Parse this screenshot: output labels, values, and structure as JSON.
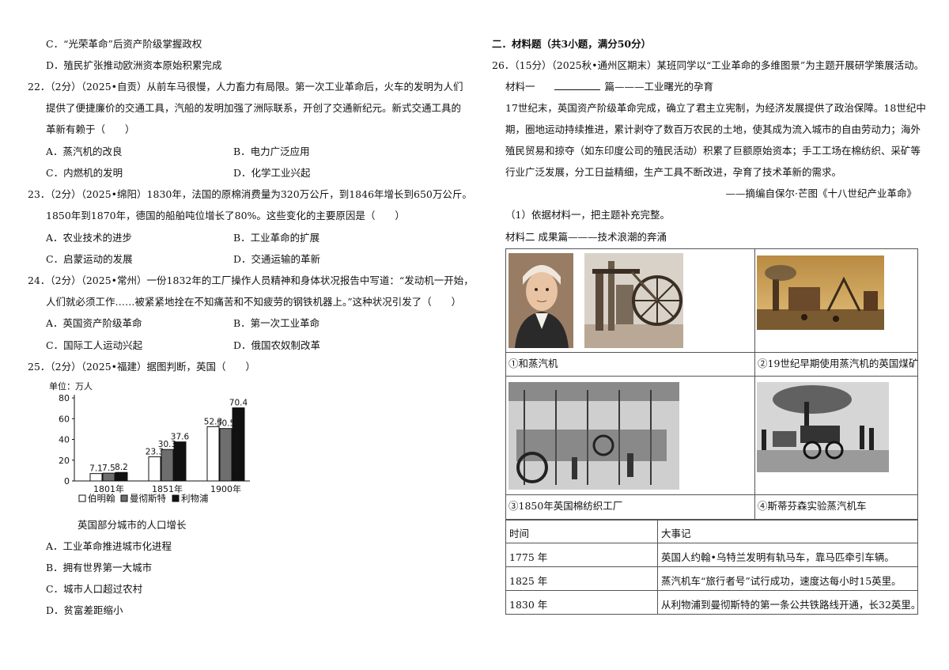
{
  "left": {
    "q21_opts": [
      "C．“光荣革命”后资产阶级掌握政权",
      "D．殖民扩张推动欧洲资本原始积累完成"
    ],
    "q22": {
      "lines": [
        "22．（2分）（2025•自贡）从前车马很慢，人力畜力有局限。第一次工业革命后，火车的发明为人们",
        "提供了便捷廉价的交通工具，汽船的发明加强了洲际联系，开创了交通新纪元。新式交通工具的",
        "革新有赖于（　　）"
      ],
      "opts": [
        "A．蒸汽机的改良",
        "B．电力广泛应用",
        "C．内燃机的发明",
        "D．化学工业兴起"
      ]
    },
    "q23": {
      "lines": [
        "23．（2分）（2025•绵阳）1830年，法国的原棉消费量为320万公斤，到1846年增长到650万公斤。",
        "1850年到1870年，德国的船舶吨位增长了80%。这些变化的主要原因是（　　）"
      ],
      "opts": [
        "A．农业技术的进步",
        "B．工业革命的扩展",
        "C．启蒙运动的发展",
        "D．交通运输的革新"
      ]
    },
    "q24": {
      "lines": [
        "24．（2分）（2025•常州）一份1832年的工厂操作人员精神和身体状况报告中写道：“发动机一开始，",
        "人们就必须工作……被紧紧地拴在不知痛苦和不知疲劳的钢铁机器上。”这种状况引发了（　　）"
      ],
      "opts": [
        "A．英国资产阶级革命",
        "B．第一次工业革命",
        "C．国际工人运动兴起",
        "D．俄国农奴制改革"
      ]
    },
    "q25": {
      "line": "25．（2分）（2025•福建）据图判断，英国（　　）",
      "opts": [
        "A．工业革命推进城市化进程",
        "B．拥有世界第一大城市",
        "C．城市人口超过农村",
        "D．贫富差距缩小"
      ]
    }
  },
  "chart_data": {
    "type": "bar",
    "title": "英国部分城市的人口增长",
    "ylabel": "单位：万人",
    "categories": [
      "1801年",
      "1851年",
      "1900年"
    ],
    "series": [
      {
        "name": "伯明翰",
        "values": [
          7.1,
          23.3,
          52.3
        ],
        "color": "#ffffff"
      },
      {
        "name": "曼彻斯特",
        "values": [
          7.5,
          30.3,
          50.5
        ],
        "color": "#6e6e6e"
      },
      {
        "name": "利物浦",
        "values": [
          8.2,
          37.6,
          70.4
        ],
        "color": "#111111"
      }
    ],
    "yticks": [
      "0",
      "20",
      "40",
      "60",
      "80"
    ],
    "ylim": [
      0,
      80
    ],
    "legend": "bottom"
  },
  "right": {
    "section": "二．材料题（共3小题，满分50分）",
    "q26_line": "26．（15分）（2025秋•通州区期末）某班同学以“工业革命的多维图景”为主题开展研学策展活动。",
    "m1_label": "材料一",
    "m1_tail": "篇———工业曙光的孕育",
    "m1_text": [
      "17世纪末，英国资产阶级革命完成，确立了君主立宪制，为经济发展提供了政治保障。18世纪中",
      "期，圈地运动持续推进，累计剥夺了数百万农民的土地，使其成为流入城市的自由劳动力；海外",
      "殖民贸易和掠夺（如东印度公司的殖民活动）积累了巨额原始资本；手工工场在棉纺织、采矿等",
      "行业广泛发展，分工日益精细，生产工具不断改进，孕育了技术革新的需求。"
    ],
    "m1_source": "——摘编自保尔·芒图《十八世纪产业革命》",
    "q1": "（1）依据材料一，把主题补充完整。",
    "m2_label": "材料二 成果篇———技术浪潮的奔涌",
    "captions": [
      "①和蒸汽机",
      "②19世纪早期使用蒸汽机的英国煤矿",
      "③1850年英国棉纺织工厂",
      "④斯蒂芬森实验蒸汽机车"
    ],
    "events": {
      "header": [
        "时间",
        "大事记"
      ],
      "rows": [
        [
          "1775 年",
          "英国人约翰•乌特兰发明有轨马车，靠马匹牵引车辆。"
        ],
        [
          "1825 年",
          "蒸汽机车“旅行者号”试行成功，速度达每小时15英里。"
        ],
        [
          "1830 年",
          "从利物浦到曼彻斯特的第一条公共铁路线开通，长32英里。"
        ]
      ]
    }
  }
}
